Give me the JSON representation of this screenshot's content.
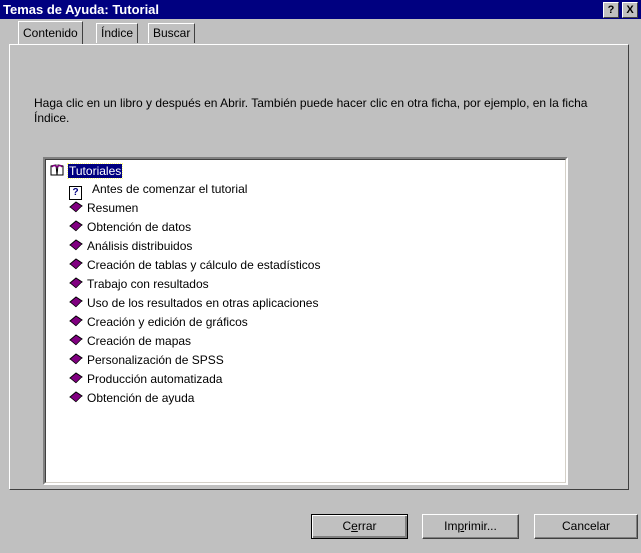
{
  "window": {
    "title": "Temas de Ayuda: Tutorial",
    "help_btn": "?",
    "close_btn": "X"
  },
  "tabs": [
    {
      "label": "Contenido",
      "active": true
    },
    {
      "label": "Índice",
      "active": false
    },
    {
      "label": "Buscar",
      "active": false
    }
  ],
  "instructions": "Haga clic en un libro  y después en Abrir. También puede hacer clic en otra ficha, por ejemplo, en la ficha Índice.",
  "tree": {
    "root": "Tutoriales",
    "items": [
      {
        "label": "Antes de comenzar el tutorial",
        "icon": "question-page-icon"
      },
      {
        "label": "Resumen",
        "icon": "book-icon"
      },
      {
        "label": "Obtención de datos",
        "icon": "book-icon"
      },
      {
        "label": "Análisis distribuidos",
        "icon": "book-icon"
      },
      {
        "label": "Creación de tablas y cálculo de estadísticos",
        "icon": "book-icon"
      },
      {
        "label": "Trabajo con resultados",
        "icon": "book-icon"
      },
      {
        "label": "Uso de los resultados en otras aplicaciones",
        "icon": "book-icon"
      },
      {
        "label": "Creación y edición de gráficos",
        "icon": "book-icon"
      },
      {
        "label": "Creación de mapas",
        "icon": "book-icon"
      },
      {
        "label": "Personalización de SPSS",
        "icon": "book-icon"
      },
      {
        "label": "Producción automatizada",
        "icon": "book-icon"
      },
      {
        "label": "Obtención de ayuda",
        "icon": "book-icon"
      }
    ]
  },
  "buttons": {
    "close_pre": "C",
    "close_u": "e",
    "close_post": "rrar",
    "print_pre": "Im",
    "print_u": "p",
    "print_post": "rimir...",
    "cancel": "Cancelar"
  },
  "colors": {
    "titlebar": "#000080",
    "face": "#c0c0c0",
    "book": "#800080"
  }
}
